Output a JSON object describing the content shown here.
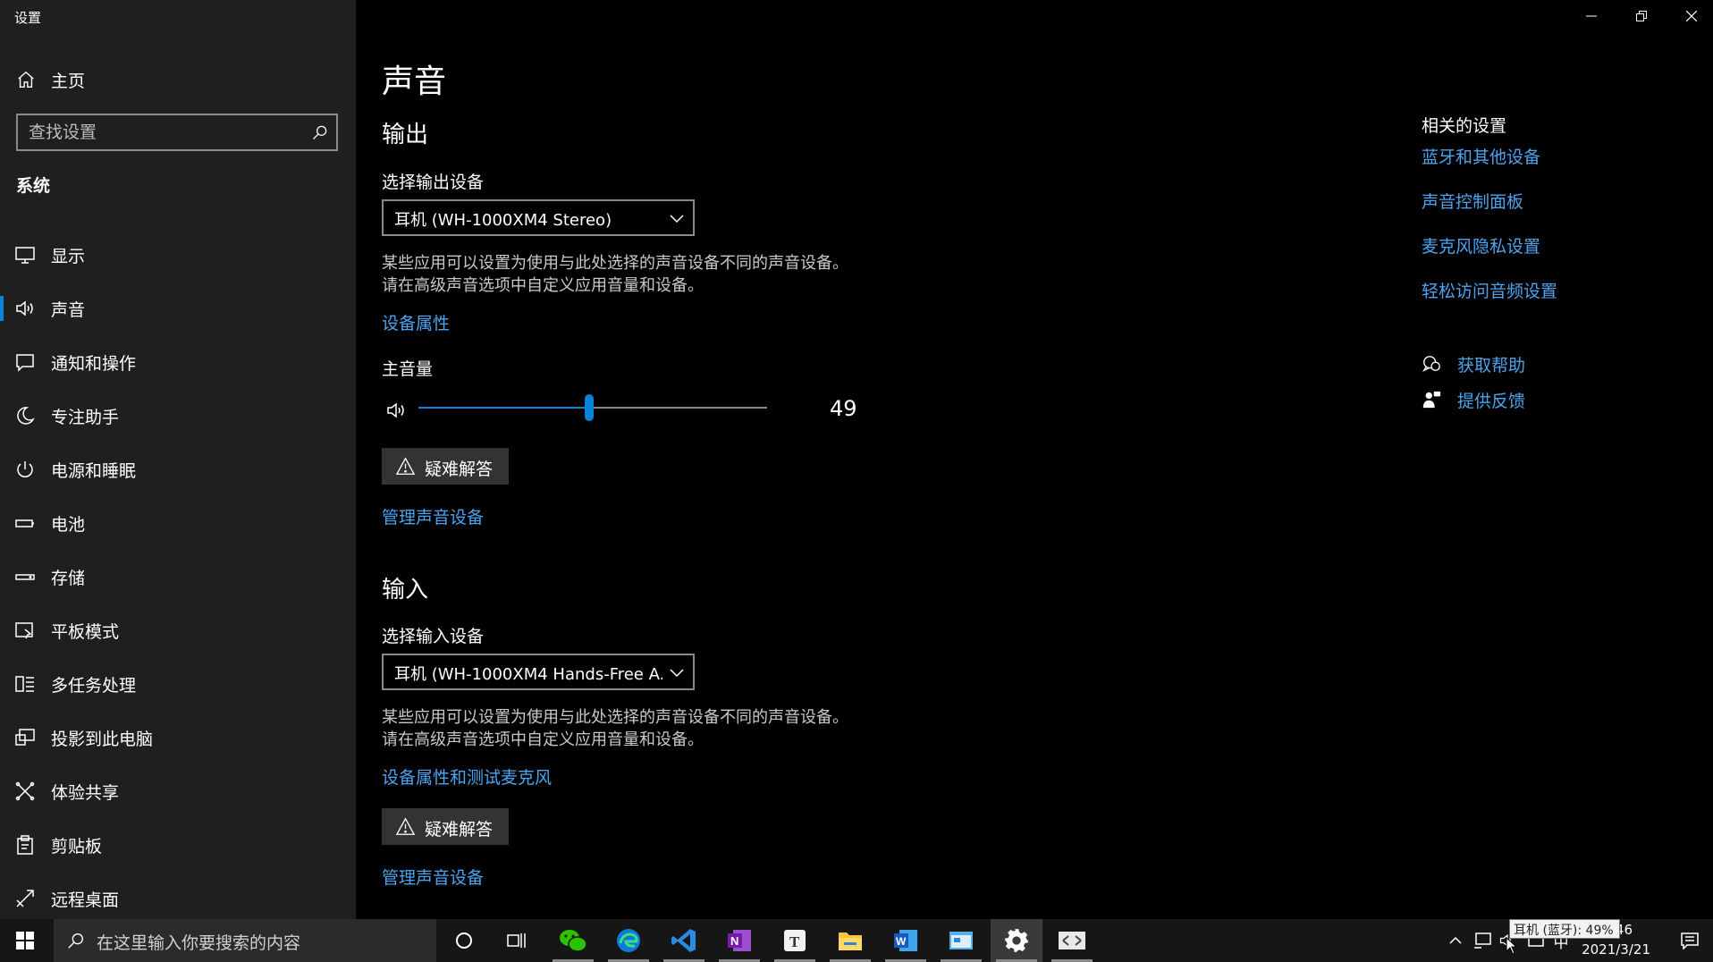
{
  "window": {
    "app_title": "设置",
    "controls": {
      "minimize": "minimize-icon",
      "restore": "restore-icon",
      "close": "close-icon"
    }
  },
  "sidebar": {
    "home_label": "主页",
    "search_placeholder": "查找设置",
    "section_label": "系统",
    "items": [
      {
        "label": "显示",
        "icon": "monitor-icon"
      },
      {
        "label": "声音",
        "icon": "speaker-icon",
        "active": true
      },
      {
        "label": "通知和操作",
        "icon": "notification-icon"
      },
      {
        "label": "专注助手",
        "icon": "moon-icon"
      },
      {
        "label": "电源和睡眠",
        "icon": "power-icon"
      },
      {
        "label": "电池",
        "icon": "battery-icon"
      },
      {
        "label": "存储",
        "icon": "storage-icon"
      },
      {
        "label": "平板模式",
        "icon": "tablet-icon"
      },
      {
        "label": "多任务处理",
        "icon": "multitask-icon"
      },
      {
        "label": "投影到此电脑",
        "icon": "project-icon"
      },
      {
        "label": "体验共享",
        "icon": "share-icon"
      },
      {
        "label": "剪贴板",
        "icon": "clipboard-icon"
      },
      {
        "label": "远程桌面",
        "icon": "remote-desktop-icon"
      }
    ]
  },
  "main": {
    "title": "声音",
    "output": {
      "heading": "输出",
      "device_label": "选择输出设备",
      "device_value": "耳机 (WH-1000XM4 Stereo)",
      "desc_line1": "某些应用可以设置为使用与此处选择的声音设备不同的声音设备。",
      "desc_line2": "请在高级声音选项中自定义应用音量和设备。",
      "properties_link": "设备属性",
      "volume_label": "主音量",
      "volume_value": "49",
      "volume_fraction": 0.49,
      "troubleshoot_label": "疑难解答",
      "manage_link": "管理声音设备"
    },
    "input": {
      "heading": "输入",
      "device_label": "选择输入设备",
      "device_value": "耳机 (WH-1000XM4 Hands-Free A...",
      "desc_line1": "某些应用可以设置为使用与此处选择的声音设备不同的声音设备。",
      "desc_line2": "请在高级声音选项中自定义应用音量和设备。",
      "properties_link": "设备属性和测试麦克风",
      "troubleshoot_label": "疑难解答",
      "manage_link": "管理声音设备"
    },
    "related": {
      "title": "相关的设置",
      "links": [
        "蓝牙和其他设备",
        "声音控制面板",
        "麦克风隐私设置",
        "轻松访问音频设置"
      ],
      "help_label": "获取帮助",
      "feedback_label": "提供反馈"
    }
  },
  "taskbar": {
    "search_placeholder": "在这里输入你要搜索的内容",
    "apps": [
      "cortana-icon",
      "task-view-icon",
      "wechat-icon",
      "edge-icon",
      "vscode-icon",
      "onenote-icon",
      "typora-icon",
      "file-explorer-icon",
      "word-icon",
      "control-panel-icon",
      "settings-icon",
      "switch-icon"
    ],
    "ime": "中",
    "time_partial": "46",
    "date": "2021/3/21",
    "tooltip": "耳机 (蓝牙): 49%"
  },
  "colors": {
    "accent": "#0a84d8",
    "link": "#4ca4f0",
    "sidebar_bg": "#1f1f1f",
    "main_bg": "#000000"
  }
}
